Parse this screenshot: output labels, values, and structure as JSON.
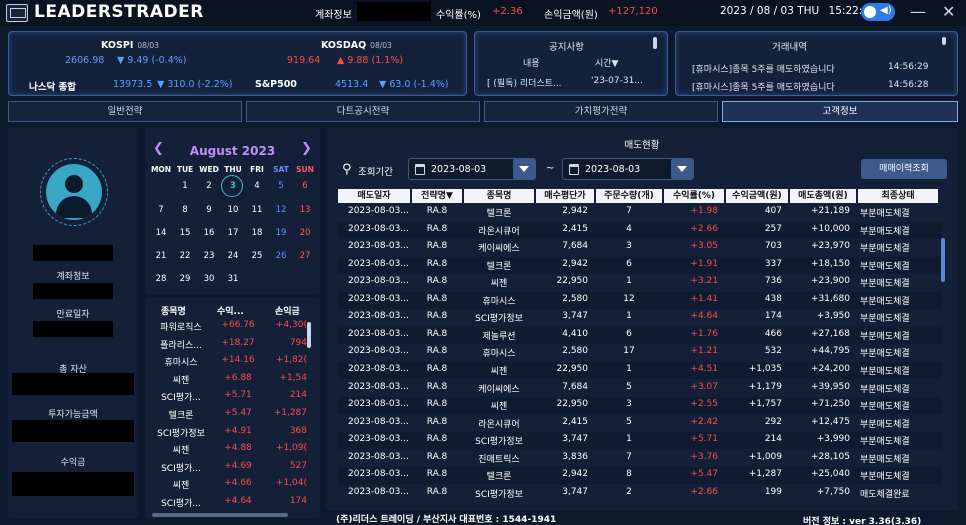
{
  "topbar": {
    "logo": "LEADERSTRADER",
    "account_label": "계좌정보",
    "return_label": "수익률(%)",
    "return_value": "+2.36",
    "profit_label": "손익금액(원)",
    "profit_value": "+127,120",
    "date": "2023 / 08 / 03 THU",
    "time": "15:22:13",
    "speaker_icon": "speaker-icon",
    "minimize": "—",
    "close": "✕"
  },
  "indices": [
    {
      "name": "KOSPI",
      "date": "08/03",
      "value": "2606.98",
      "change": "▼ 9.49 (-0.4%)",
      "color": "#5aa0ff"
    },
    {
      "name": "KOSDAQ",
      "date": "08/03",
      "value": "919.64",
      "change": "▲ 9.88 (1.1%)",
      "color": "#ff4a4a"
    },
    {
      "name": "나스닥 종합",
      "date": "",
      "value": "13973.5",
      "change": "▼ 310.0 (-2.2%)",
      "color": "#5aa0ff"
    },
    {
      "name": "S&P500",
      "date": "",
      "value": "4513.4",
      "change": "▼ 63.0 (-1.4%)",
      "color": "#5aa0ff"
    }
  ],
  "notice": {
    "title": "공지사항",
    "col_content": "내용",
    "col_time": "시간▼",
    "row_content": "[ (필독) 리더스트...",
    "row_time": "'23-07-31..."
  },
  "trades": {
    "title": "거래내역",
    "rows": [
      {
        "text": "[휴마시스]종목 5주를 매도하였습니다",
        "time": "14:56:29"
      },
      {
        "text": "[휴마시스]종목 5주를 매도하였습니다",
        "time": "14:56:28"
      }
    ]
  },
  "tabs": [
    "일반전략",
    "다트공시전략",
    "가치평가전략",
    "고객정보"
  ],
  "left": {
    "avatar_icon": "user-avatar-icon",
    "account_label": "계좌정보",
    "expiry_label": "만료일자",
    "total_assets_label": "총 자산",
    "investable_label": "투자가능금액",
    "profit_label": "수익금"
  },
  "calendar": {
    "title": "August 2023",
    "prev": "❮",
    "next": "❯",
    "dow": [
      "MON",
      "TUE",
      "WED",
      "THU",
      "FRI",
      "SAT",
      "SUN"
    ],
    "weeks": [
      [
        "",
        "1",
        "2",
        "3",
        "4",
        "5",
        "6"
      ],
      [
        "7",
        "8",
        "9",
        "10",
        "11",
        "12",
        "13"
      ],
      [
        "14",
        "15",
        "16",
        "17",
        "18",
        "19",
        "20"
      ],
      [
        "21",
        "22",
        "23",
        "24",
        "25",
        "26",
        "27"
      ],
      [
        "28",
        "29",
        "30",
        "31",
        "",
        "",
        ""
      ]
    ],
    "today": "3"
  },
  "pl_table": {
    "headers": [
      "종목명",
      "수익...",
      "손익금"
    ],
    "rows": [
      [
        "파워로직스",
        "+66.76",
        "+4,30("
      ],
      [
        "폴라리스...",
        "+18.27",
        "794"
      ],
      [
        "휴마시스",
        "+14.16",
        "+1,82("
      ],
      [
        "씨젠",
        "+6.88",
        "+1,54"
      ],
      [
        "SCI평가...",
        "+5.71",
        "214"
      ],
      [
        "텔크론",
        "+5.47",
        "+1,287"
      ],
      [
        "SCI평가정보",
        "+4.91",
        "368"
      ],
      [
        "씨젠",
        "+4.88",
        "+1,09("
      ],
      [
        "SCI평가...",
        "+4.69",
        "527"
      ],
      [
        "씨젠",
        "+4.66",
        "+1,04("
      ],
      [
        "SCI평가...",
        "+4.64",
        "174"
      ]
    ]
  },
  "sales": {
    "title": "매도현황",
    "search_label": "조회기간",
    "search_icon": "search-icon",
    "date_from": "2023-08-03",
    "date_to": "2023-08-03",
    "tilde": "~",
    "query_button": "매매이력조회",
    "headers": [
      "매도일자",
      "전략명▼",
      "종목명",
      "매수평단가",
      "주문수량(개)",
      "수익률(%)",
      "수익금액(원)",
      "매도총액(원)",
      "최종상태"
    ],
    "rows": [
      [
        "2023-08-03...",
        "RA.8",
        "텔크론",
        "2,942",
        "7",
        "+1.98",
        "407",
        "+21,189",
        "부분매도체결"
      ],
      [
        "2023-08-03...",
        "RA.8",
        "라온시큐어",
        "2,415",
        "4",
        "+2.66",
        "257",
        "+10,000",
        "부분매도체결"
      ],
      [
        "2023-08-03...",
        "RA.8",
        "케이씨에스",
        "7,684",
        "3",
        "+3.05",
        "703",
        "+23,970",
        "부분매도체결"
      ],
      [
        "2023-08-03...",
        "RA.8",
        "텔크론",
        "2,942",
        "6",
        "+1.91",
        "337",
        "+18,150",
        "부분매도체결"
      ],
      [
        "2023-08-03...",
        "RA.8",
        "씨젠",
        "22,950",
        "1",
        "+3.21",
        "736",
        "+23,900",
        "부분매도체결"
      ],
      [
        "2023-08-03...",
        "RA.8",
        "휴마시스",
        "2,580",
        "12",
        "+1.41",
        "438",
        "+31,680",
        "부분매도체결"
      ],
      [
        "2023-08-03...",
        "RA.8",
        "SCI평가정보",
        "3,747",
        "1",
        "+4.64",
        "174",
        "+3,950",
        "부분매도체결"
      ],
      [
        "2023-08-03...",
        "RA.8",
        "제놀루션",
        "4,410",
        "6",
        "+1.76",
        "466",
        "+27,168",
        "부분매도체결"
      ],
      [
        "2023-08-03...",
        "RA.8",
        "휴마시스",
        "2,580",
        "17",
        "+1.21",
        "532",
        "+44,795",
        "부분매도체결"
      ],
      [
        "2023-08-03...",
        "RA.8",
        "씨젠",
        "22,950",
        "1",
        "+4.51",
        "+1,035",
        "+24,200",
        "부분매도체결"
      ],
      [
        "2023-08-03...",
        "RA.8",
        "케이씨에스",
        "7,684",
        "5",
        "+3.07",
        "+1,179",
        "+39,950",
        "부분매도체결"
      ],
      [
        "2023-08-03...",
        "RA.8",
        "씨젠",
        "22,950",
        "3",
        "+2.55",
        "+1,757",
        "+71,250",
        "부분매도체결"
      ],
      [
        "2023-08-03...",
        "RA.8",
        "라온시큐어",
        "2,415",
        "5",
        "+2.42",
        "292",
        "+12,475",
        "부분매도체결"
      ],
      [
        "2023-08-03...",
        "RA.8",
        "SCI평가정보",
        "3,747",
        "1",
        "+5.71",
        "214",
        "+3,990",
        "부분매도체결"
      ],
      [
        "2023-08-03...",
        "RA.8",
        "진매트릭스",
        "3,836",
        "7",
        "+3.76",
        "+1,009",
        "+28,105",
        "부분매도체결"
      ],
      [
        "2023-08-03...",
        "RA.8",
        "텔크론",
        "2,942",
        "8",
        "+5.47",
        "+1,287",
        "+25,040",
        "부분매도체결"
      ],
      [
        "2023-08-03...",
        "RA.8",
        "SCI평가정보",
        "3,747",
        "2",
        "+2.66",
        "199",
        "+7,750",
        "매도체결완료"
      ]
    ]
  },
  "footer": {
    "company": "(주)리더스 트레이딩 / 부산지사 대표번호 : 1544-1941",
    "version": "버전 정보 : ver 3.36(3.36)"
  }
}
